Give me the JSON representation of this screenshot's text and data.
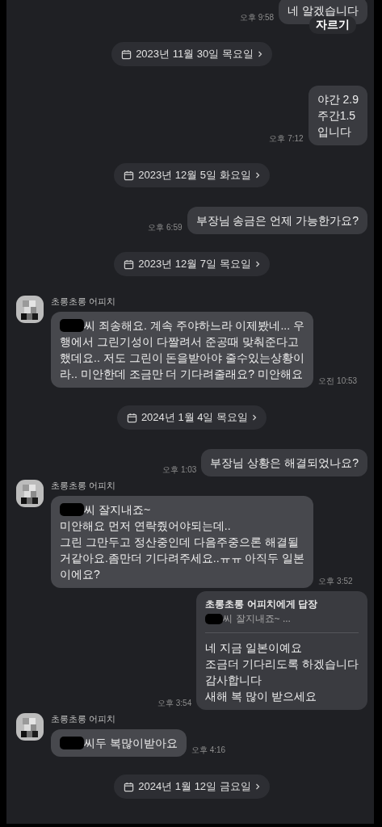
{
  "messages": [
    {
      "kind": "sent",
      "text": "네 알겠습니다",
      "time": "오후 9:58",
      "overlay": "자르기"
    },
    {
      "kind": "date",
      "text": "2023년 11월 30일 목요일"
    },
    {
      "kind": "sent",
      "text": "야간 2.9\n주간1.5\n입니다",
      "time": "오후 7:12"
    },
    {
      "kind": "date",
      "text": "2023년 12월 5일 화요일"
    },
    {
      "kind": "sent",
      "text": "부장님 송금은 언제 가능한가요?",
      "time": "오후 6:59"
    },
    {
      "kind": "date",
      "text": "2023년 12월 7일 목요일"
    },
    {
      "kind": "received",
      "sender": "초롱초롱 어피치",
      "redacted": true,
      "text": "씨 죄송해요. 계속 주야하느라 이제봤네... 우\n행에서 그린기성이 다짤려서 준공때 맞춰준다고\n했데요.. 저도 그린이 돈을받아야 줄수있는상황이\n라.. 미안한데 조금만 더 기다려줄래요? 미안해요",
      "time": "오전 10:53"
    },
    {
      "kind": "date",
      "text": "2024년 1월 4일 목요일"
    },
    {
      "kind": "sent",
      "text": "부장님 상황은 해결되었나요?",
      "time": "오후 1:03"
    },
    {
      "kind": "received",
      "sender": "초롱초롱 어피치",
      "redacted": true,
      "text": "씨 잘지내죠~\n미안해요 먼저 연락줬어야되는데..\n그린 그만두고 정산중인데 다음주중으론 해결될\n거같아요.좀만더 기다려주세요..ㅠㅠ 아직두 일본\n이에요?",
      "time": "오후 3:52"
    },
    {
      "kind": "sent",
      "reply_to": "초롱초롱 어피치에게 답장",
      "quote": "씨 잘지내죠~ ...",
      "quote_redacted": true,
      "text": "네 지금 일본이예요\n조금더 기다리도록 하겠습니다\n감사합니다\n새해 복 많이 받으세요",
      "time": "오후 3:54"
    },
    {
      "kind": "received",
      "sender": "초롱초롱 어피치",
      "redacted": true,
      "text": "씨두 복많이받아요",
      "time": "오후 4:16"
    },
    {
      "kind": "date",
      "text": "2024년 1월 12일 금요일"
    }
  ]
}
